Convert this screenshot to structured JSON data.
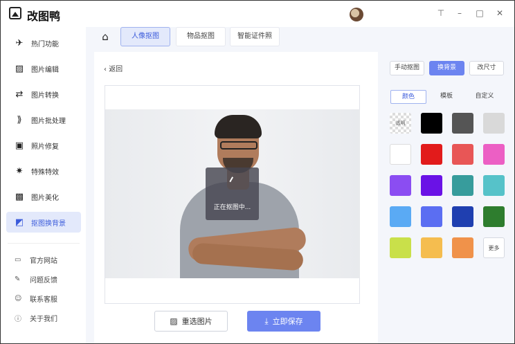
{
  "app": {
    "title": "改图鸭"
  },
  "sidebar": {
    "items": [
      {
        "label": "热门功能",
        "icon": "rocket-icon"
      },
      {
        "label": "图片编辑",
        "icon": "image-edit-icon"
      },
      {
        "label": "图片转换",
        "icon": "convert-icon"
      },
      {
        "label": "图片批处理",
        "icon": "batch-icon"
      },
      {
        "label": "照片修复",
        "icon": "photo-restore-icon"
      },
      {
        "label": "特殊特效",
        "icon": "effects-icon"
      },
      {
        "label": "图片美化",
        "icon": "beautify-icon"
      },
      {
        "label": "抠图换背景",
        "icon": "cutout-icon"
      }
    ],
    "links": [
      {
        "label": "官方网站",
        "icon": "website-icon"
      },
      {
        "label": "问题反馈",
        "icon": "feedback-icon"
      },
      {
        "label": "联系客服",
        "icon": "support-icon"
      },
      {
        "label": "关于我们",
        "icon": "info-icon"
      }
    ]
  },
  "tabs": [
    "人像抠图",
    "物品抠图",
    "智能证件照"
  ],
  "main": {
    "back_label": "返回",
    "overlay_text": "正在抠图中...",
    "reselect_label": "重选图片",
    "save_label": "立即保存"
  },
  "right_panel": {
    "mode_buttons": [
      "手动抠图",
      "换背景",
      "改尺寸"
    ],
    "sub_tabs": [
      "颜色",
      "模板",
      "自定义"
    ],
    "transparent_label": "透明",
    "more_label": "更多",
    "colors": [
      "#000000",
      "#555555",
      "#d9d9d9",
      "#ffffff",
      "#e21b1b",
      "#e85656",
      "#ec5fc4",
      "#8b4df2",
      "#6a12e6",
      "#379c9c",
      "#56c2c9",
      "#5aaaf4",
      "#5b6ef2",
      "#1f3fb0",
      "#2e7d2e",
      "#c9e04a",
      "#f5bd4f",
      "#f0924a"
    ]
  }
}
